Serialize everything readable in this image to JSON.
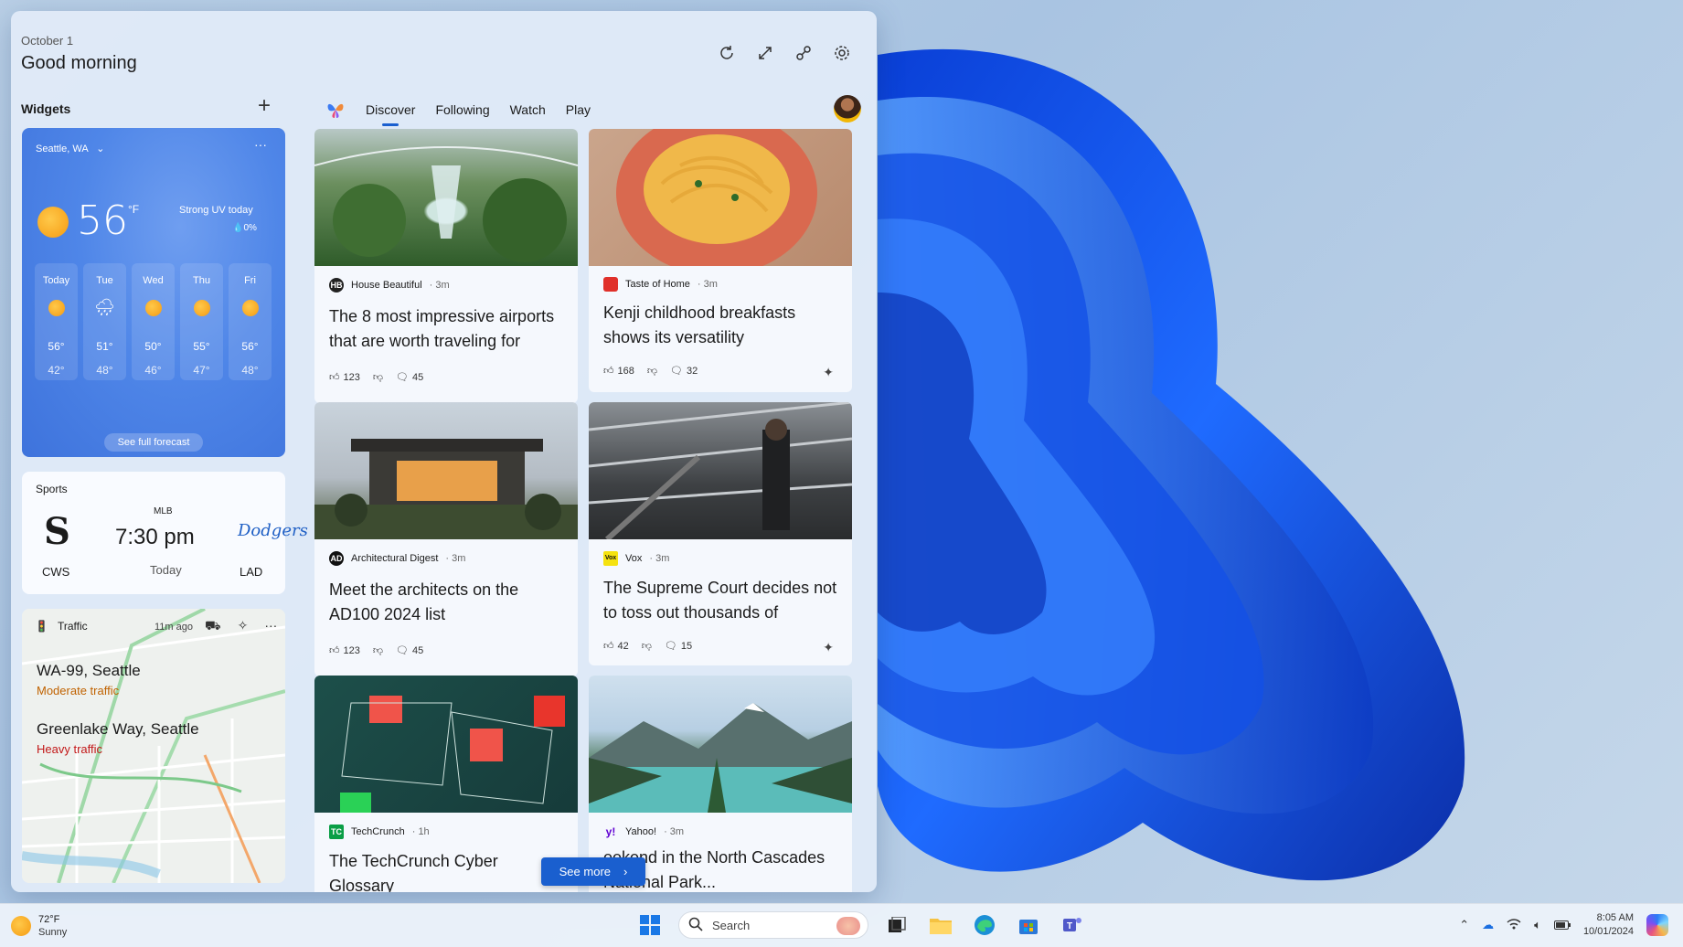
{
  "header": {
    "date": "October 1",
    "greeting": "Good morning"
  },
  "top_actions": [
    "refresh-icon",
    "expand-icon",
    "share-icon",
    "settings-icon"
  ],
  "widgets": {
    "label": "Widgets",
    "add": "+"
  },
  "weather": {
    "location": "Seattle, WA",
    "temp": "56",
    "unit": "°F",
    "condition_note": "Strong UV today",
    "precip": "0%",
    "forecast": [
      {
        "day": "Today",
        "icon": "sun",
        "hi": "56°",
        "lo": "42°"
      },
      {
        "day": "Tue",
        "icon": "rain",
        "hi": "51°",
        "lo": "48°"
      },
      {
        "day": "Wed",
        "icon": "sun",
        "hi": "50°",
        "lo": "46°"
      },
      {
        "day": "Thu",
        "icon": "sun",
        "hi": "55°",
        "lo": "47°"
      },
      {
        "day": "Fri",
        "icon": "sun",
        "hi": "56°",
        "lo": "48°"
      }
    ],
    "forecast_button": "See full forecast"
  },
  "sports": {
    "label": "Sports",
    "league": "MLB",
    "time": "7:30 pm",
    "when": "Today",
    "team_home": "CWS",
    "team_away": "LAD",
    "logo_home": "S",
    "logo_away": "Dodgers"
  },
  "traffic": {
    "label": "Traffic",
    "ago": "11m ago",
    "routes": [
      {
        "name": "WA-99, Seattle",
        "status": "Moderate traffic"
      },
      {
        "name": "Greenlake Way, Seattle",
        "status": "Heavy traffic"
      }
    ]
  },
  "feed": {
    "tabs": [
      "Discover",
      "Following",
      "Watch",
      "Play"
    ],
    "active_tab": "Discover",
    "see_more": "See more",
    "cards": [
      {
        "source": "House Beautiful",
        "badge": "HB",
        "age": "3m",
        "title": "The 8 most impressive airports that are worth traveling for",
        "likes": "123",
        "comments": "45"
      },
      {
        "source": "Taste of Home",
        "badge": "",
        "age": "3m",
        "title": "Kenji childhood breakfasts shows its versatility",
        "likes": "168",
        "comments": "32"
      },
      {
        "source": "Architectural Digest",
        "badge": "AD",
        "age": "3m",
        "title": "Meet the architects on the AD100 2024 list",
        "likes": "123",
        "comments": "45"
      },
      {
        "source": "Vox",
        "badge": "Vox",
        "age": "3m",
        "title": "The Supreme Court decides not to toss out thousands of",
        "likes": "42",
        "comments": "15"
      },
      {
        "source": "TechCrunch",
        "badge": "TC",
        "age": "1h",
        "title": "The TechCrunch Cyber Glossary"
      },
      {
        "source": "Yahoo!",
        "badge": "y!",
        "age": "3m",
        "title": "eekend in the North Cascades National Park..."
      }
    ]
  },
  "taskbar": {
    "weather_temp": "72°F",
    "weather_cond": "Sunny",
    "search_placeholder": "Search",
    "time": "8:05 AM",
    "date": "10/01/2024"
  }
}
